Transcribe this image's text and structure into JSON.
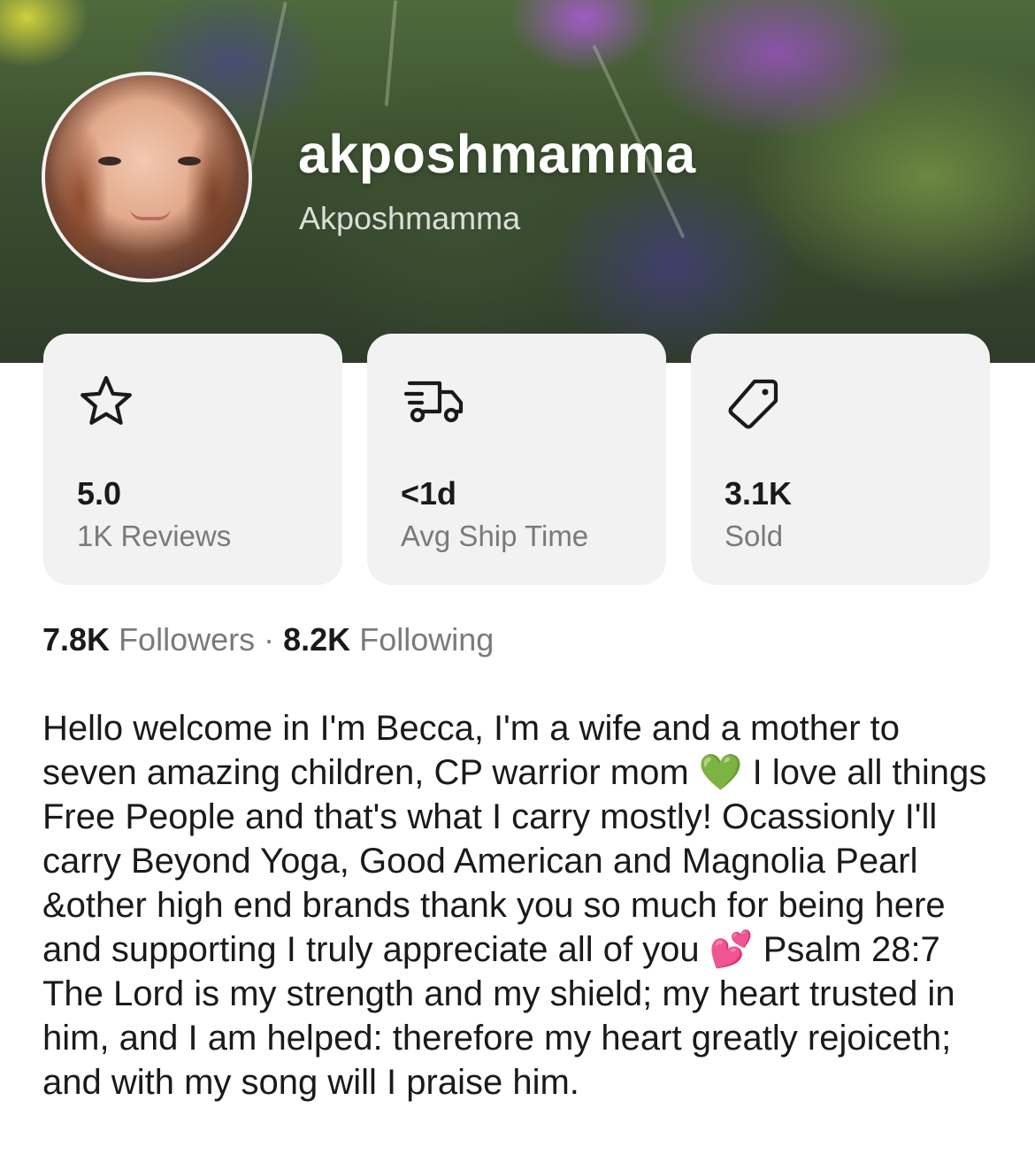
{
  "profile": {
    "username": "akposhmamma",
    "display_name": "Akposhmamma"
  },
  "stats": [
    {
      "icon": "star-icon",
      "value": "5.0",
      "label": "1K Reviews"
    },
    {
      "icon": "truck-icon",
      "value": "<1d",
      "label": "Avg Ship Time"
    },
    {
      "icon": "tag-icon",
      "value": "3.1K",
      "label": "Sold"
    }
  ],
  "social": {
    "followers_count": "7.8K",
    "followers_label": "Followers",
    "separator": "·",
    "following_count": "8.2K",
    "following_label": "Following"
  },
  "bio": "Hello welcome in I'm Becca, I'm a wife and a mother to seven amazing children, CP warrior mom 💚 I love all things Free People and that's what I carry mostly! Ocassionly I'll carry Beyond Yoga, Good American and Magnolia Pearl &other high end brands thank you so much for being here and supporting I truly appreciate all of you 💕 Psalm 28:7 The Lord is my strength and my shield; my heart trusted in him, and I am helped: therefore my heart greatly rejoiceth; and with my song will I praise him.",
  "colors": {
    "card_bg": "#f2f2f2",
    "muted_text": "#7a7a7a",
    "primary_text": "#1a1a1a"
  }
}
